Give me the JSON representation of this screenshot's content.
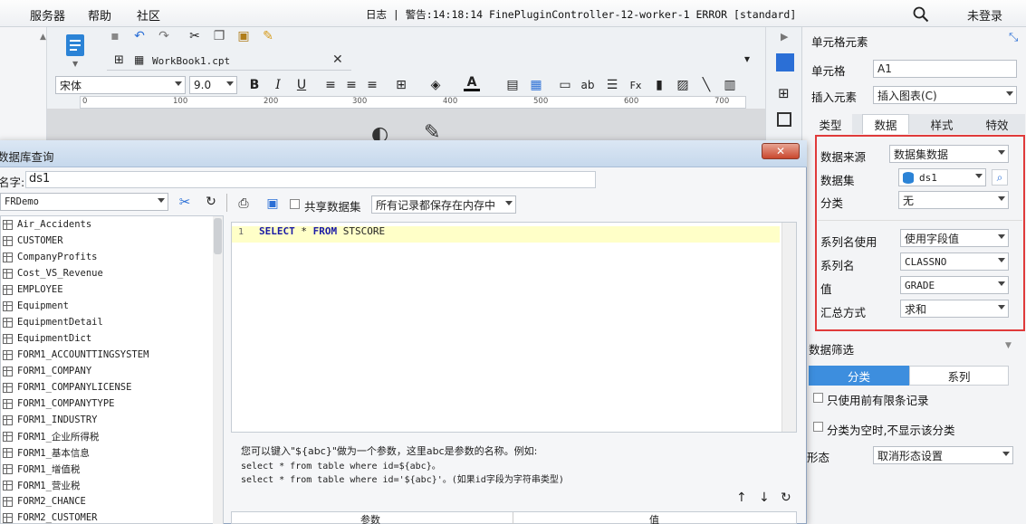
{
  "menubar": {
    "items": [
      "服务器",
      "帮助",
      "社区"
    ],
    "log": "日志 | 警告:14:18:14 FinePluginController-12-worker-1 ERROR [standard]",
    "login": "未登录"
  },
  "tab": {
    "label": "WorkBook1.cpt"
  },
  "format": {
    "font": "宋体",
    "size": "9.0"
  },
  "ruler": [
    "0",
    "100",
    "200",
    "300",
    "400",
    "500",
    "600",
    "700"
  ],
  "panel": {
    "title": "单元格元素",
    "cell_label": "单元格",
    "cell_value": "A1",
    "insert_label": "插入元素",
    "insert_value": "插入图表(C)",
    "tabs": [
      "类型",
      "数据",
      "样式",
      "特效"
    ],
    "data_source_label": "数据来源",
    "data_source_value": "数据集数据",
    "dataset_label": "数据集",
    "dataset_value": "ds1",
    "category_label": "分类",
    "category_value": "无",
    "series_use_label": "系列名使用",
    "series_use_value": "使用字段值",
    "series_name_label": "系列名",
    "series_name_value": "CLASSNO",
    "value_label": "值",
    "value_value": "GRADE",
    "agg_label": "汇总方式",
    "agg_value": "求和",
    "filter_title": "数据筛选",
    "seg_category": "分类",
    "seg_series": "系列",
    "only_first": "只使用前有限条记录",
    "hide_empty": "分类为空时,不显示该分类",
    "shape_label": "形态",
    "shape_value": "取消形态设置"
  },
  "dialog": {
    "title": "数据库查询",
    "name_label": "名字:",
    "name_value": "ds1",
    "connection": "FRDemo",
    "share_label": "共享数据集",
    "memory_option": "所有记录都保存在内存中",
    "tables": [
      "Air_Accidents",
      "CUSTOMER",
      "CompanyProfits",
      "Cost_VS_Revenue",
      "EMPLOYEE",
      "Equipment",
      "EquipmentDetail",
      "EquipmentDict",
      "FORM1_ACCOUNTTINGSYSTEM",
      "FORM1_COMPANY",
      "FORM1_COMPANYLICENSE",
      "FORM1_COMPANYTYPE",
      "FORM1_INDUSTRY",
      "FORM1_企业所得税",
      "FORM1_基本信息",
      "FORM1_增值税",
      "FORM1_营业税",
      "FORM2_CHANCE",
      "FORM2_CUSTOMER"
    ],
    "line_no": "1",
    "sql_kw1": "SELECT",
    "sql_star": " * ",
    "sql_kw2": "FROM",
    "sql_table": " STSCORE",
    "hint1": "您可以键入\"${abc}\"做为一个参数，这里abc是参数的名称。例如:",
    "hint2": "select * from table where id=${abc}。",
    "hint3": "select * from table where id='${abc}'。(如果id字段为字符串类型)",
    "param_col": "参数",
    "value_col": "值"
  }
}
